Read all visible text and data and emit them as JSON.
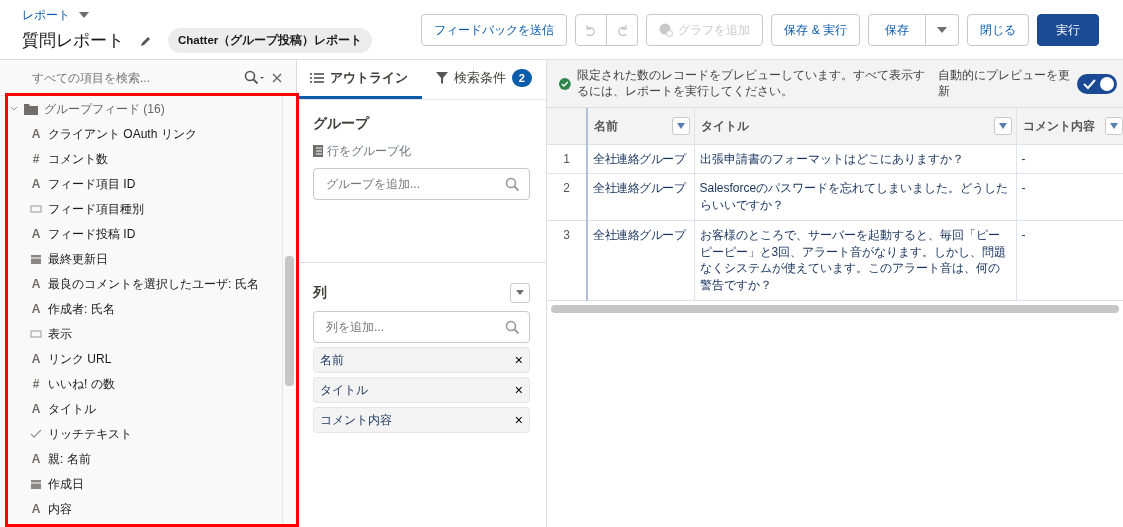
{
  "header": {
    "breadcrumb": "レポート",
    "title": "質問レポート",
    "report_type": "Chatter（グループ投稿）レポート",
    "buttons": [
      {
        "label": "フィードバックを送信",
        "kind": "outline",
        "disabled": false
      },
      {
        "kind": "undo",
        "disabled": true
      },
      {
        "label": "グラフを追加",
        "kind": "chart",
        "disabled": true
      },
      {
        "label": "保存 & 実行",
        "kind": "outline",
        "disabled": false
      },
      {
        "label": "保存",
        "kind": "split",
        "disabled": false
      },
      {
        "label": "閉じる",
        "kind": "outline",
        "disabled": false
      },
      {
        "label": "実行",
        "kind": "brand",
        "disabled": false
      }
    ]
  },
  "sidebar": {
    "highlighted": true,
    "search": {
      "placeholder": "すべての項目を検索..."
    },
    "folder": {
      "label": "グループフィード (16)",
      "expanded": true,
      "children": [
        {
          "label": "クライアント OAuth リンク",
          "kind": "text",
          "glyph": "A"
        },
        {
          "label": "コメント数",
          "kind": "number",
          "glyph": "#"
        },
        {
          "label": "フィード項目 ID",
          "kind": "text",
          "glyph": "A"
        },
        {
          "label": "フィード項目種別",
          "kind": "picklist"
        },
        {
          "label": "フィード投稿 ID",
          "kind": "text",
          "glyph": "A"
        },
        {
          "label": "最終更新日",
          "kind": "date"
        },
        {
          "label": "最良のコメントを選択したユーザ: 氏名",
          "kind": "text",
          "glyph": "A"
        },
        {
          "label": "作成者: 氏名",
          "kind": "text",
          "glyph": "A"
        },
        {
          "label": "表示",
          "kind": "picklist"
        },
        {
          "label": "リンク URL",
          "kind": "text",
          "glyph": "A"
        },
        {
          "label": "いいね! の数",
          "kind": "number",
          "glyph": "#"
        },
        {
          "label": "タイトル",
          "kind": "text",
          "glyph": "A"
        },
        {
          "label": "リッチテキスト",
          "kind": "checkbox"
        },
        {
          "label": "親: 名前",
          "kind": "text",
          "glyph": "A"
        },
        {
          "label": "作成日",
          "kind": "date"
        },
        {
          "label": "内容",
          "kind": "text",
          "glyph": "A"
        }
      ]
    }
  },
  "tabs": [
    {
      "label": "アウトライン",
      "kind": "outline",
      "selected": true
    },
    {
      "label": "検索条件",
      "kind": "filter",
      "selected": false,
      "badge": "2"
    }
  ],
  "outline": {
    "group_title": "グループ",
    "group_rows_label": "行をグループ化",
    "group_placeholder": "グループを追加...",
    "columns_title": "列",
    "columns_placeholder": "列を追加...",
    "columns": [
      {
        "label": "名前",
        "remove": "×"
      },
      {
        "label": "タイトル",
        "remove": "×"
      },
      {
        "label": "コメント内容",
        "remove": "×"
      }
    ]
  },
  "preview": {
    "notice": "限定された数のレコードをプレビューしています。すべて表示するには、レポートを実行してください。",
    "auto_update_label": "自動的にプレビューを更新",
    "auto_update_on": true,
    "table": {
      "columns": [
        "名前",
        "タイトル",
        "コメント内容"
      ],
      "rows": [
        {
          "number": "1",
          "cells": [
            "全社連絡グループ",
            "出張申請書のフォーマットはどこにありますか？",
            "-"
          ]
        },
        {
          "number": "2",
          "cells": [
            "全社連絡グループ",
            "Salesforceのパスワードを忘れてしまいました。どうしたらいいですか？",
            "-"
          ]
        },
        {
          "number": "3",
          "cells": [
            "全社連絡グループ",
            "お客様のところで、サーバーを起動すると、毎回「ピーピーピー」と3回、アラート音がなります。しかし、問題なくシステムが使えています。このアラート音は、何の警告ですか？",
            "-"
          ]
        }
      ]
    }
  }
}
